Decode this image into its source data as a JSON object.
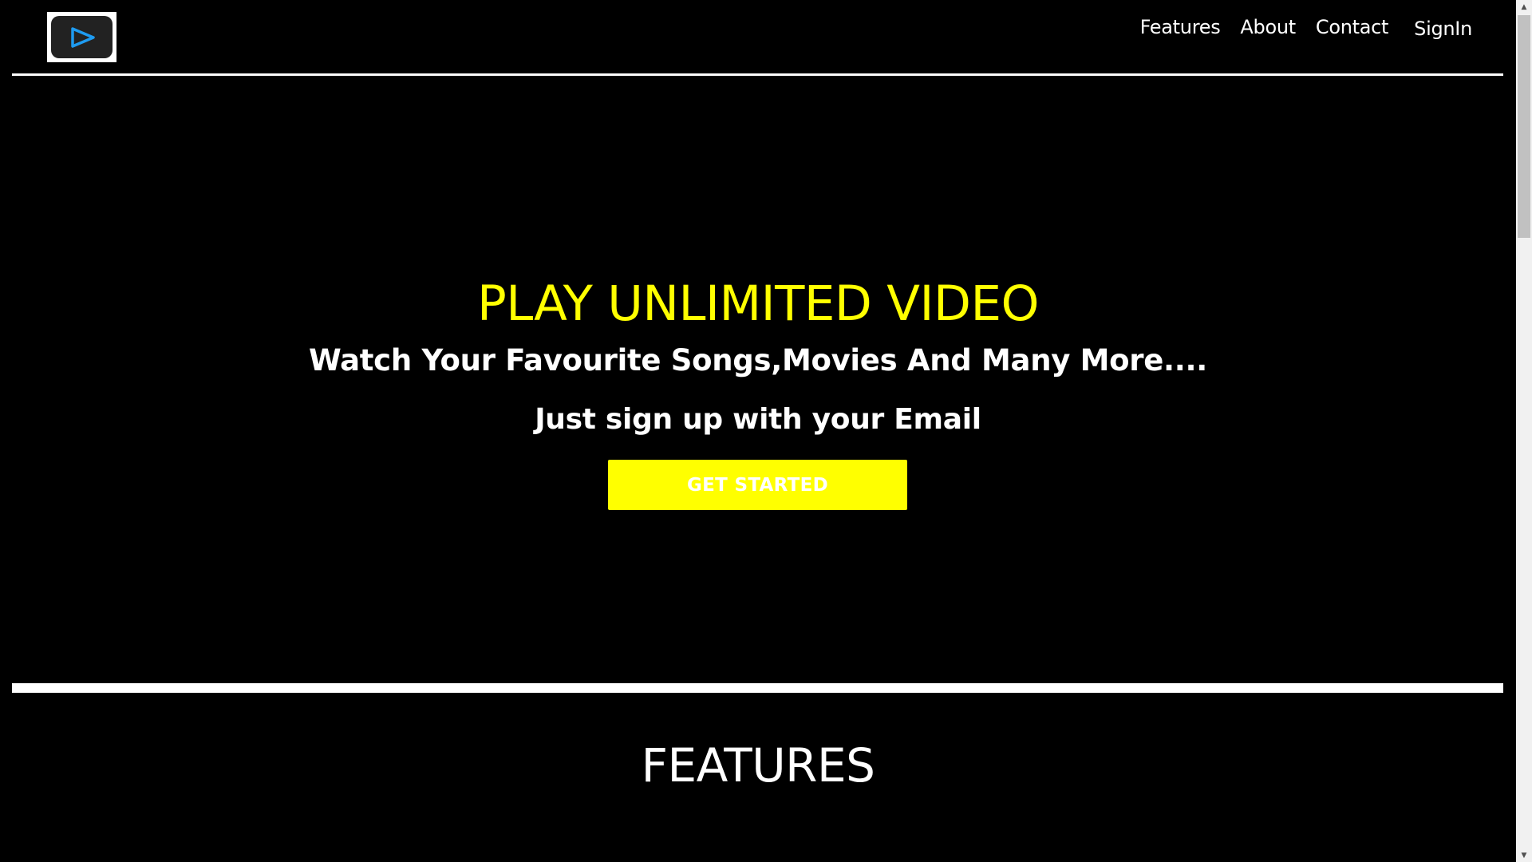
{
  "header": {
    "logo_alt": "play logo",
    "nav": [
      {
        "label": "Features"
      },
      {
        "label": "About"
      },
      {
        "label": "Contact"
      },
      {
        "label": "SignIn"
      }
    ]
  },
  "hero": {
    "title": "PLAY UNLIMITED VIDEO",
    "subtitle": "Watch Your Favourite Songs,Movies And Many More....",
    "signup_text": "Just sign up with your Email",
    "cta_label": "GET STARTED"
  },
  "features": {
    "title": "FEATURES"
  },
  "colors": {
    "background": "#000000",
    "accent": "#ffff00",
    "text": "#ffffff",
    "logo_play": "#1e9bf0"
  },
  "icons": {
    "logo": "play-icon",
    "scroll_up": "arrow-up-icon",
    "scroll_down": "arrow-down-icon"
  }
}
